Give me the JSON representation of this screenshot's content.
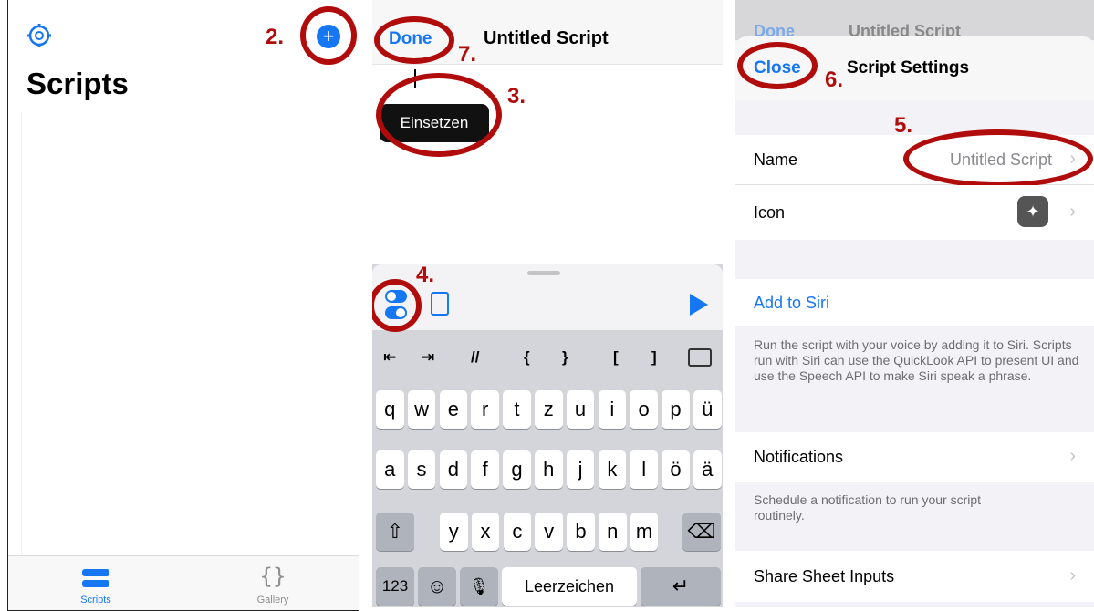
{
  "scripts_panel": {
    "title": "Scripts",
    "tabs": [
      {
        "label": "Scripts",
        "icon": "stack-icon"
      },
      {
        "label": "Gallery",
        "icon": "braces-icon"
      }
    ],
    "step_label": "2."
  },
  "editor_panel": {
    "done": "Done",
    "title": "Untitled Script",
    "paste": "Einsetzen",
    "symbols": [
      "⇤",
      "⇥",
      "//",
      "{",
      "}",
      "[",
      "]"
    ],
    "keys_row1": [
      "q",
      "w",
      "e",
      "r",
      "t",
      "z",
      "u",
      "i",
      "o",
      "p",
      "ü"
    ],
    "keys_row2": [
      "a",
      "s",
      "d",
      "f",
      "g",
      "h",
      "j",
      "k",
      "l",
      "ö",
      "ä"
    ],
    "keys_row3": [
      "y",
      "x",
      "c",
      "v",
      "b",
      "n",
      "m"
    ],
    "num_key": "123",
    "space": "Leerzeichen",
    "steps": [
      "7.",
      "3.",
      "4."
    ]
  },
  "settings_panel": {
    "behind_done": "Done",
    "behind_title": "Untitled Script",
    "close": "Close",
    "title": "Script Settings",
    "name_label": "Name",
    "name_value": "Untitled Script",
    "icon_label": "Icon",
    "add_to_siri": "Add to Siri",
    "siri_note": "Run the script with your voice by adding it to Siri. Scripts run with Siri can use the QuickLook API to present UI and use the Speech API to make Siri speak a phrase.",
    "notifications": "Notifications",
    "notif_note": "Schedule a notification to run your script routinely.",
    "share_sheet": "Share Sheet Inputs",
    "steps": [
      "6.",
      "5."
    ]
  },
  "colors": {
    "accent": "#1677f5",
    "annotation": "#b10c0c"
  }
}
